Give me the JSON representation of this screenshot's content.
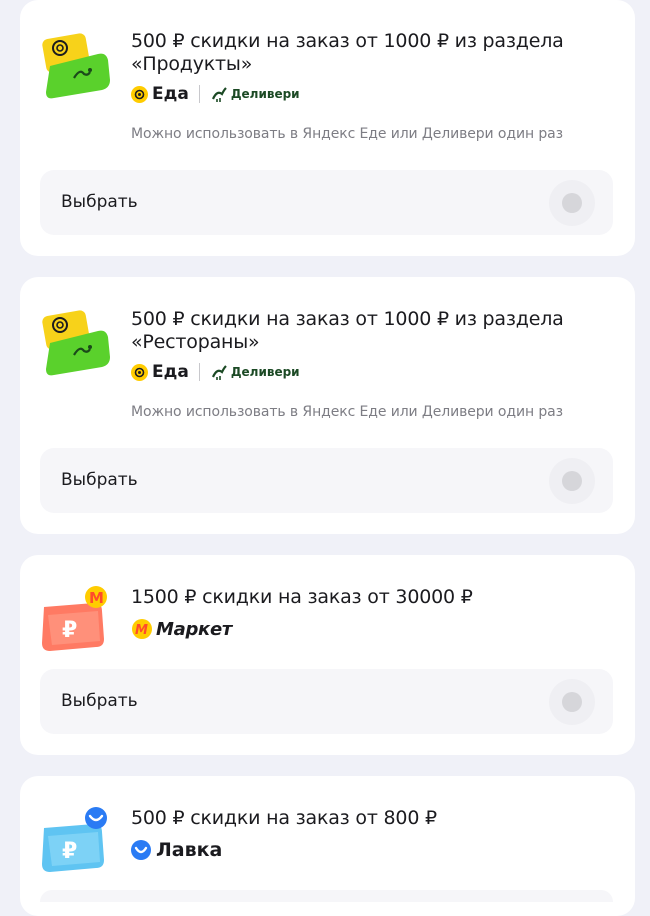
{
  "offers": [
    {
      "title": "500 ₽ скидки на заказ от 1000 ₽ из раздела «Продукты»",
      "brand_primary": "Еда",
      "brand_secondary": "Деливери",
      "note": "Можно использовать в Яндекс Еде или Деливери один раз",
      "action_label": "Выбрать"
    },
    {
      "title": "500 ₽ скидки на заказ от 1000 ₽ из раздела «Рестораны»",
      "brand_primary": "Еда",
      "brand_secondary": "Деливери",
      "note": "Можно использовать в Яндекс Еде или Деливери один раз",
      "action_label": "Выбрать"
    },
    {
      "title": "1500 ₽ скидки на заказ от 30000 ₽",
      "brand_primary": "Маркет",
      "action_label": "Выбрать"
    },
    {
      "title": "500 ₽ скидки на заказ от 800 ₽",
      "brand_primary": "Лавка"
    }
  ],
  "colors": {
    "eda_yellow": "#ffcc00",
    "delivery_green": "#1c4a25",
    "market_red": "#ff4b2b",
    "lavka_blue": "#2a7bf4"
  },
  "icons": [
    "eda-logo-icon",
    "delivery-ostrich-icon",
    "market-logo-icon",
    "lavka-logo-icon",
    "coupon-icon",
    "toggle-icon"
  ]
}
